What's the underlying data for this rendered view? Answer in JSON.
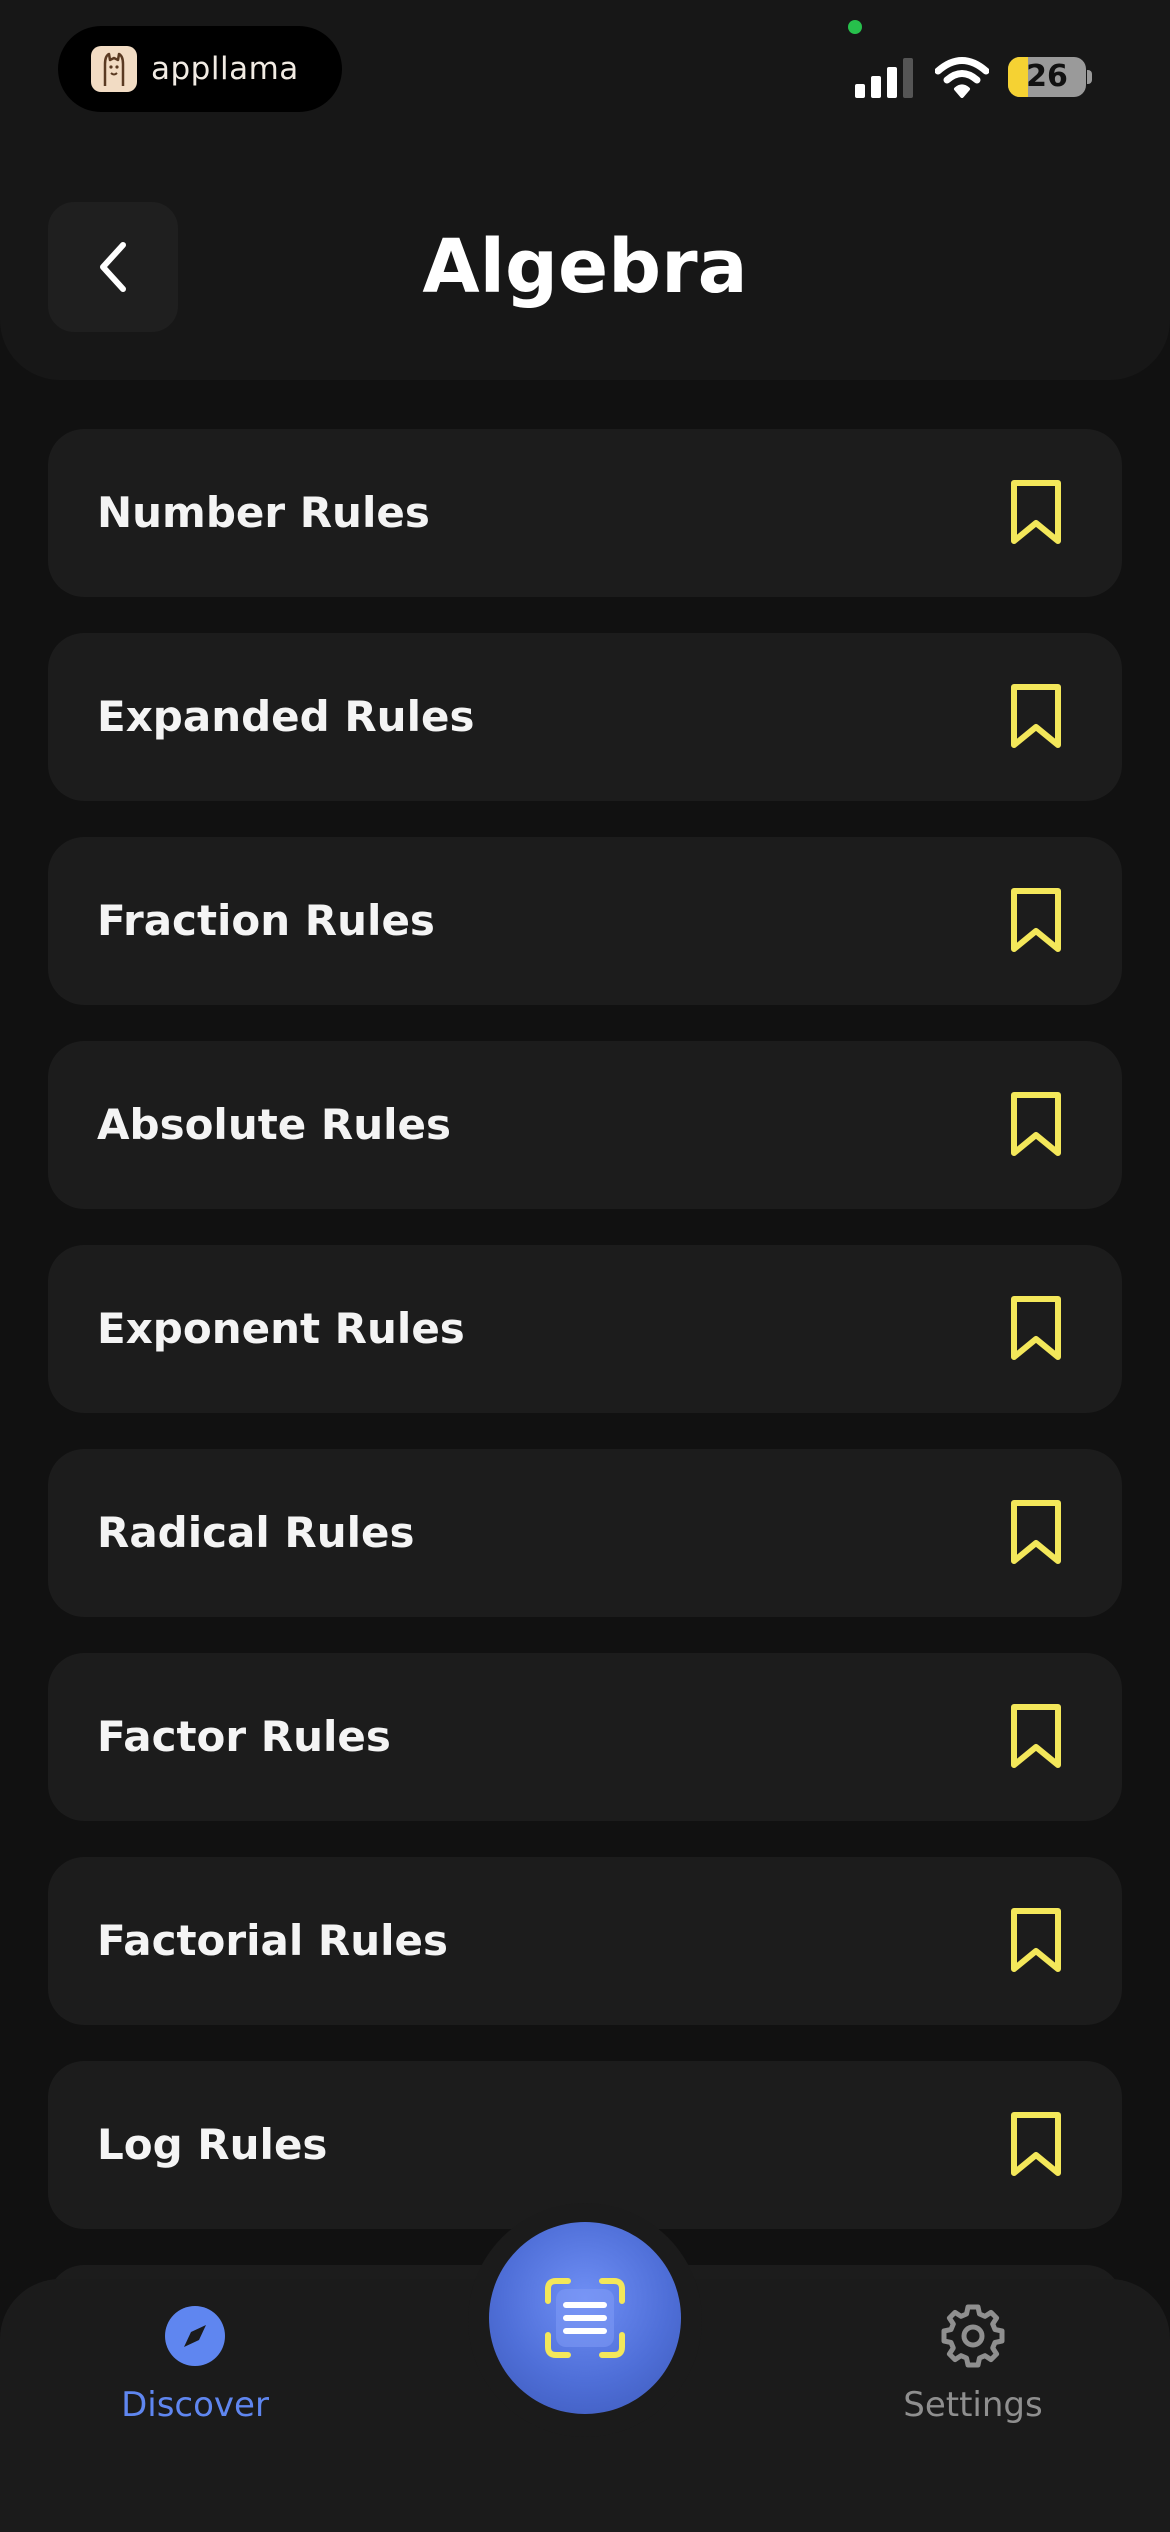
{
  "status_bar": {
    "brand_name": "appllama",
    "battery_level": 26,
    "battery_text": "26"
  },
  "header": {
    "title": "Algebra",
    "back_icon": "chevron-left-icon"
  },
  "rules": [
    {
      "label": "Number Rules",
      "bookmark_icon": "bookmark-icon"
    },
    {
      "label": "Expanded Rules",
      "bookmark_icon": "bookmark-icon"
    },
    {
      "label": "Fraction Rules",
      "bookmark_icon": "bookmark-icon"
    },
    {
      "label": "Absolute Rules",
      "bookmark_icon": "bookmark-icon"
    },
    {
      "label": "Exponent Rules",
      "bookmark_icon": "bookmark-icon"
    },
    {
      "label": "Radical Rules",
      "bookmark_icon": "bookmark-icon"
    },
    {
      "label": "Factor Rules",
      "bookmark_icon": "bookmark-icon"
    },
    {
      "label": "Factorial Rules",
      "bookmark_icon": "bookmark-icon"
    },
    {
      "label": "Log Rules",
      "bookmark_icon": "bookmark-icon"
    },
    {
      "label": "",
      "bookmark_icon": "bookmark-icon"
    }
  ],
  "bottom_nav": {
    "discover_label": "Discover",
    "settings_label": "Settings",
    "discover_icon": "compass-icon",
    "settings_icon": "gear-icon",
    "scan_icon": "scan-icon"
  },
  "colors": {
    "accent_blue": "#5f86f0",
    "bookmark_yellow": "#f3e75a",
    "background": "#111111",
    "card": "#1c1c1c"
  }
}
